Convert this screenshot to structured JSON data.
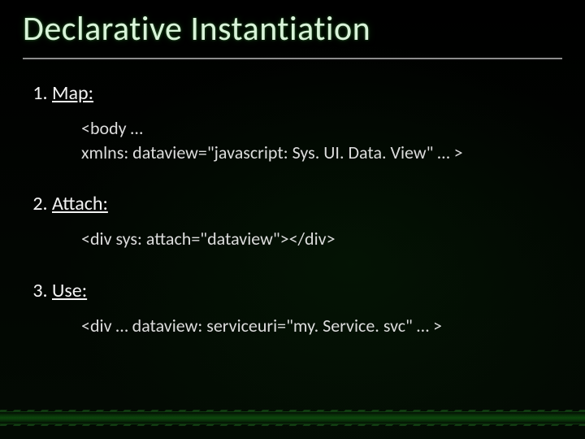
{
  "title": "Declarative Instantiation",
  "steps": [
    {
      "label": "Map:",
      "code": "<body …\nxmlns: dataview=\"javascript: Sys. UI. Data. View\" … >"
    },
    {
      "label": "Attach:",
      "code": "<div sys: attach=\"dataview\"></div>"
    },
    {
      "label": "Use:",
      "code": "<div … dataview: serviceuri=\"my. Service. svc\" … >"
    }
  ]
}
